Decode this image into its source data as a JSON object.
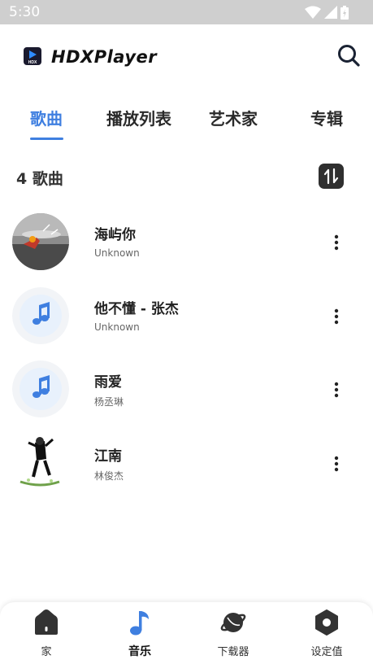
{
  "status_bar": {
    "time": "5:30"
  },
  "header": {
    "app_name": "HDXPlayer",
    "logo_name_a": "HD",
    "logo_name_x": "X",
    "logo_name_b": "Player",
    "logo_badge": "HDX"
  },
  "tabs": [
    {
      "label": "歌曲",
      "active": true
    },
    {
      "label": "播放列表",
      "active": false
    },
    {
      "label": "艺术家",
      "active": false
    },
    {
      "label": "专辑",
      "active": false
    }
  ],
  "song_count": "4 歌曲",
  "songs": [
    {
      "title": "海屿你",
      "artist": "Unknown",
      "art": "photo-sunset"
    },
    {
      "title": "他不懂 - 张杰",
      "artist": "Unknown",
      "art": "music-note-icon"
    },
    {
      "title": "雨爱",
      "artist": "杨丞琳",
      "art": "music-note-icon"
    },
    {
      "title": "江南",
      "artist": "林俊杰",
      "art": "photo-figure"
    }
  ],
  "bottom_nav": [
    {
      "label": "家",
      "icon": "home-icon",
      "active": false
    },
    {
      "label": "音乐",
      "icon": "music-note-icon",
      "active": true
    },
    {
      "label": "下载器",
      "icon": "planet-icon",
      "active": false
    },
    {
      "label": "设定值",
      "icon": "settings-hex-icon",
      "active": false
    }
  ],
  "colors": {
    "accent": "#3f7fe0",
    "status_bar": "#cfcfcf",
    "note_bg": "#e8f1fc",
    "note_ring": "#f2f4f7"
  }
}
